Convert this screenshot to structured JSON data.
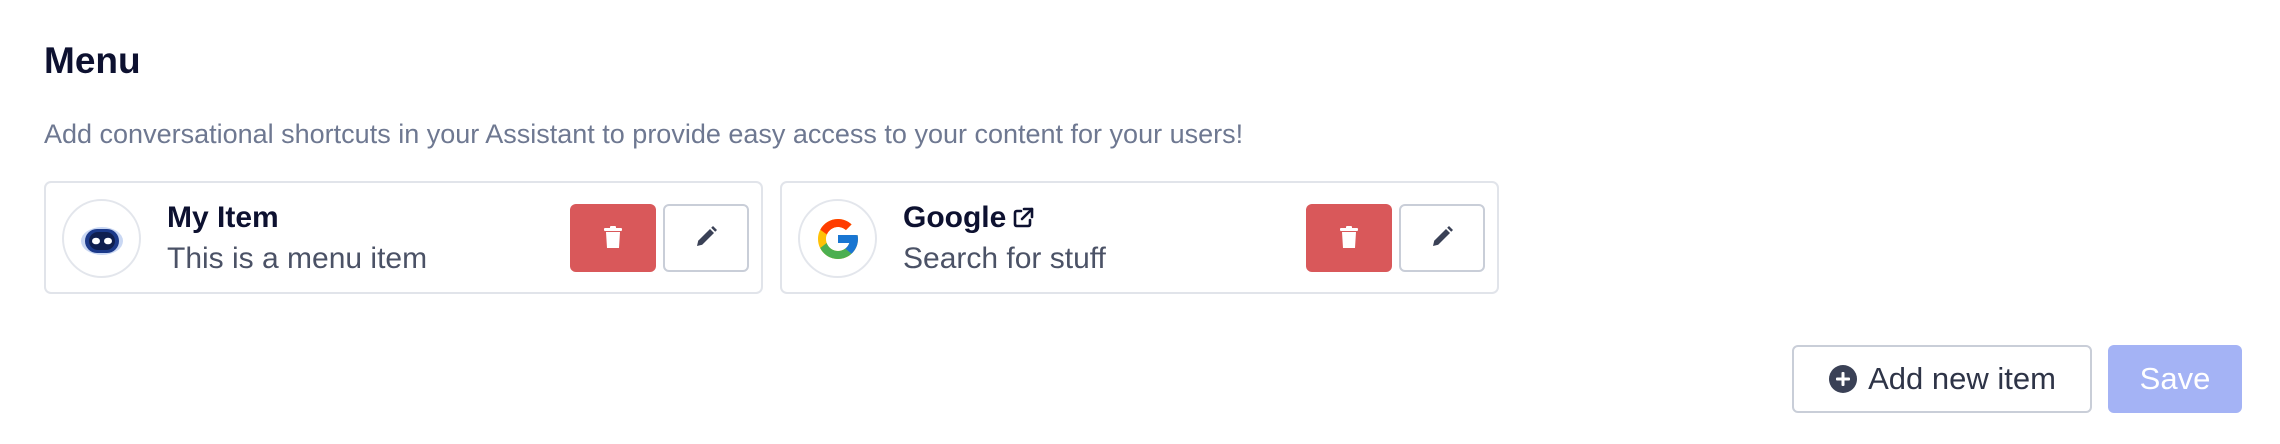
{
  "menu": {
    "title": "Menu",
    "description": "Add conversational shortcuts in your Assistant to provide easy access to your content for your users!",
    "items": [
      {
        "title": "My Item",
        "subtitle": "This is a menu item",
        "icon": "robot-assistant-icon",
        "external_link": false
      },
      {
        "title": "Google",
        "subtitle": "Search for stuff",
        "icon": "google-logo-icon",
        "external_link": true
      }
    ]
  },
  "actions": {
    "delete_icon": "trash-icon",
    "edit_icon": "pencil-icon",
    "add_label": "Add new item",
    "add_icon": "plus-circle-icon",
    "save_label": "Save",
    "save_enabled": false
  },
  "colors": {
    "delete_button": "#d9585a",
    "save_button_disabled": "#a4b3f5",
    "title_text": "#0d1130",
    "description_text": "#6e7891",
    "card_border": "#e1e4ea"
  }
}
